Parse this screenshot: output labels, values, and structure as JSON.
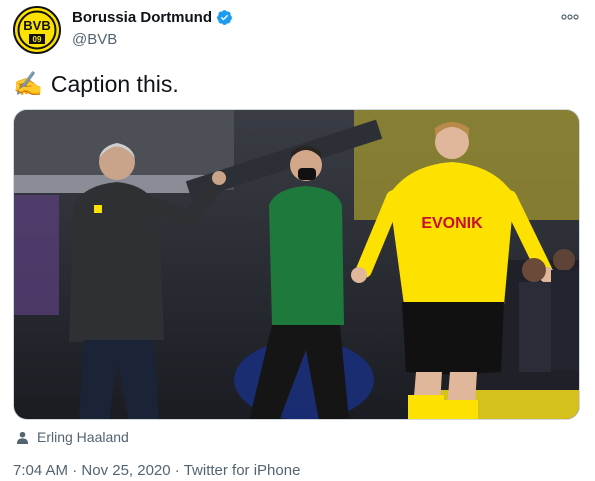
{
  "account": {
    "display_name": "Borussia Dortmund",
    "handle": "@BVB",
    "avatar_text": "BVB",
    "avatar_number": "09",
    "verified": true
  },
  "tweet": {
    "text": "Caption this.",
    "emoji": "✍️",
    "tagged_user": "Erling Haaland",
    "time": "7:04 AM",
    "date": "Nov 25, 2020",
    "source": "Twitter for iPhone",
    "separator": " · "
  },
  "icons": {
    "more": "more-icon",
    "verified": "verified-badge-icon",
    "person": "person-icon"
  },
  "colors": {
    "bvb_yellow": "#fde100",
    "verified_blue": "#1d9bf0",
    "secondary_text": "#536471",
    "referee_green": "#1e7a3c"
  },
  "photo": {
    "shirt_sponsor": "EVONIK"
  }
}
